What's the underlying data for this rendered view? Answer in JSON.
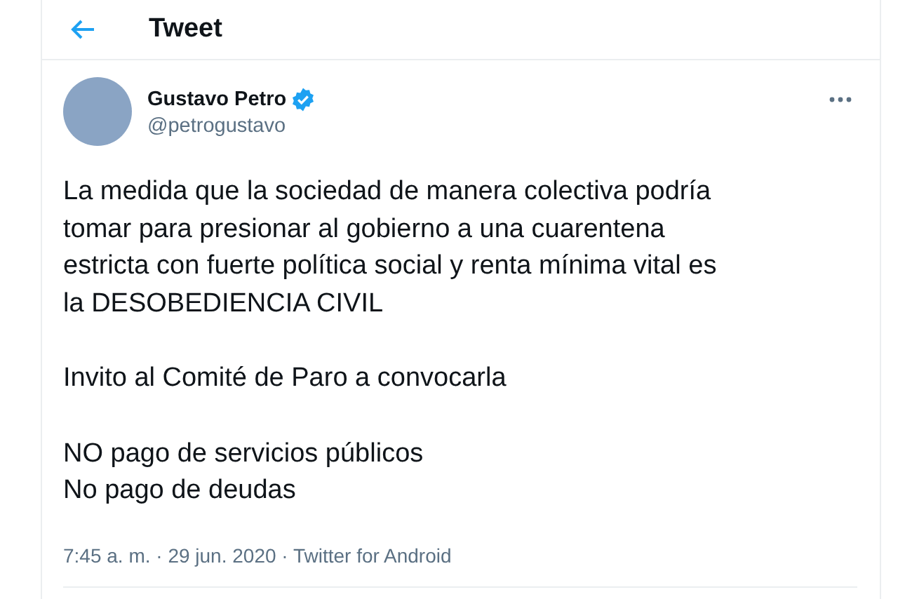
{
  "header": {
    "title": "Tweet"
  },
  "author": {
    "name": "Gustavo Petro",
    "verified": true,
    "handle": "@petrogustavo"
  },
  "paragraphs": [
    "La medida que la sociedad de manera colectiva podría\ntomar para presionar al gobierno a una cuarentena\nestricta con fuerte política social y renta mínima vital es\nla DESOBEDIENCIA CIVIL",
    "Invito al Comité de Paro a convocarla",
    "NO pago de servicios públicos\nNo pago de deudas"
  ],
  "meta": "7:45 a. m. · 29 jun. 2020 · Twitter for Android"
}
